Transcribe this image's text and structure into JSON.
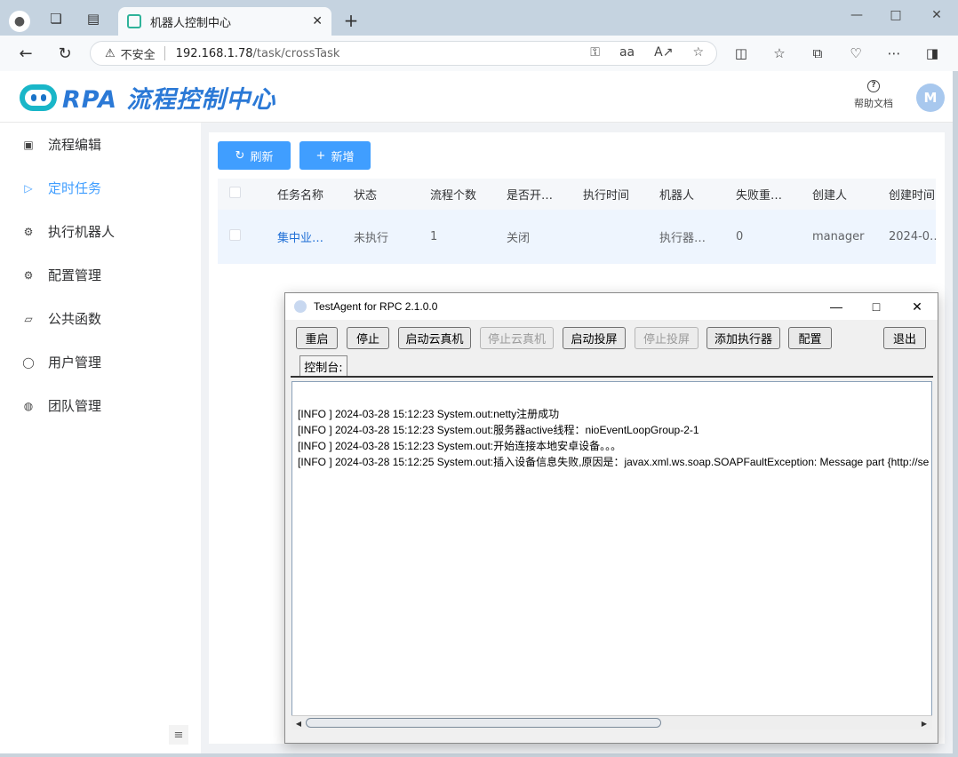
{
  "browser": {
    "tab_title": "机器人控制中心",
    "address": {
      "security_label": "不安全",
      "host": "192.168.1.78",
      "path": "/task/crossTask"
    }
  },
  "header": {
    "logo_text": "RPA 流程控制中心",
    "help_label": "帮助文档",
    "avatar_letter": "M"
  },
  "sidebar": {
    "items": [
      {
        "label": "流程编辑"
      },
      {
        "label": "定时任务"
      },
      {
        "label": "执行机器人"
      },
      {
        "label": "配置管理"
      },
      {
        "label": "公共函数"
      },
      {
        "label": "用户管理"
      },
      {
        "label": "团队管理"
      }
    ]
  },
  "toolbar": {
    "refresh_label": "刷新",
    "add_label": "新增"
  },
  "table": {
    "columns": [
      "任务名称",
      "状态",
      "流程个数",
      "是否开…",
      "执行时间",
      "机器人",
      "失败重…",
      "创建人",
      "创建时间"
    ],
    "rows": [
      [
        "集中业…",
        "未执行",
        "1",
        "关闭",
        "",
        "执行器…",
        "0",
        "manager",
        "2024-0…"
      ]
    ]
  },
  "agent_window": {
    "title": "TestAgent for RPC 2.1.0.0",
    "buttons": [
      "重启",
      "停止",
      "启动云真机",
      "停止云真机",
      "启动投屏",
      "停止投屏",
      "添加执行器",
      "配置",
      "退出"
    ],
    "tab_label": "控制台:",
    "console_lines": [
      "[INFO ] 2024-03-28 15:12:23 System.out:netty注册成功",
      "[INFO ] 2024-03-28 15:12:23 System.out:服务器active线程：nioEventLoopGroup-2-1",
      "[INFO ] 2024-03-28 15:12:23 System.out:开始连接本地安卓设备。。。",
      "[INFO ] 2024-03-28 15:12:25 System.out:插入设备信息失败,原因是：javax.xml.ws.soap.SOAPFaultException: Message part {http://se"
    ]
  },
  "colors": {
    "primary": "#409eff",
    "logo_blue": "#2b79d6",
    "link": "#1f6fd6"
  }
}
